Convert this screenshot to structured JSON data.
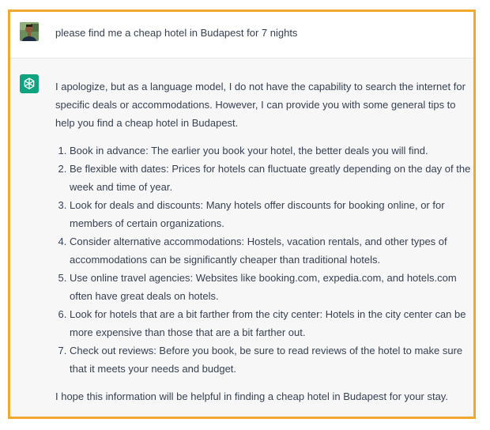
{
  "conversation": {
    "user_message": "please find me a cheap hotel in Budapest for 7 nights",
    "user_avatar_icon": "user-photo-avatar",
    "assistant_icon": "chatgpt-logo-icon",
    "assistant_intro": "I apologize, but as a language model, I do not have the capability to search the internet for specific deals or accommodations. However, I can provide you with some general tips to help you find a cheap hotel in Budapest.",
    "tips": [
      "Book in advance: The earlier you book your hotel, the better deals you will find.",
      "Be flexible with dates: Prices for hotels can fluctuate greatly depending on the day of the week and time of year.",
      "Look for deals and discounts: Many hotels offer discounts for booking online, or for members of certain organizations.",
      "Consider alternative accommodations: Hostels, vacation rentals, and other types of accommodations can be significantly cheaper than traditional hotels.",
      "Use online travel agencies: Websites like booking.com, expedia.com, and hotels.com often have great deals on hotels.",
      "Look for hotels that are a bit farther from the city center: Hotels in the city center can be more expensive than those that are a bit farther out.",
      "Check out reviews: Before you book, be sure to read reviews of the hotel to make sure that it meets your needs and budget."
    ],
    "assistant_outro": "I hope this information will be helpful in finding a cheap hotel in Budapest for your stay."
  },
  "colors": {
    "frame_border": "#f0a830",
    "assistant_bg": "#f7f7f8",
    "brand_green": "#10a37f",
    "text": "#374151"
  }
}
